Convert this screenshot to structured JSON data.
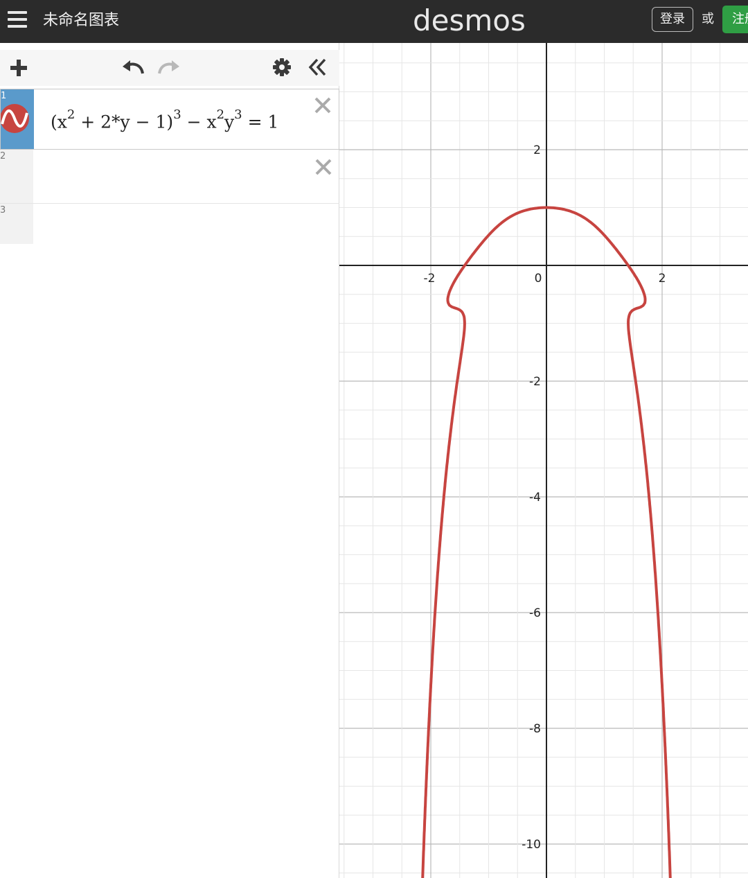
{
  "header": {
    "menu_icon": "hamburger-menu-icon",
    "graph_title": "未命名图表",
    "logo": "desmos",
    "login_label": "登录",
    "or_label": "或",
    "signup_label": "注册"
  },
  "toolbar": {
    "add_icon": "plus-icon",
    "undo_icon": "undo-icon",
    "redo_icon": "redo-icon",
    "settings_icon": "gear-icon",
    "collapse_icon": "double-chevron-left-icon"
  },
  "expressions": [
    {
      "index": "1",
      "latex": "(x^2 + 2*y - 1)^3 - x^2 y^3 = 1",
      "color": "#c74440",
      "icon": "graph-wave-icon"
    },
    {
      "index": "2",
      "latex": ""
    },
    {
      "index": "3",
      "latex": ""
    }
  ],
  "math_parts": {
    "open": "(x",
    "e1": "2",
    "mid1": " + 2*y − 1)",
    "e2": "3",
    "mid2": " − x",
    "e3": "2",
    "mid3": "y",
    "e4": "3",
    "end": " = 1"
  },
  "graph": {
    "x_range": [
      -3.5,
      3.5
    ],
    "y_range": [
      -10.5,
      4.0
    ],
    "x_tick_labels": [
      "-2",
      "0",
      "2"
    ],
    "y_tick_labels": [
      "2",
      "-2",
      "-4",
      "-6",
      "-8",
      "-10"
    ],
    "curve_color": "#c74440",
    "grid": true
  }
}
